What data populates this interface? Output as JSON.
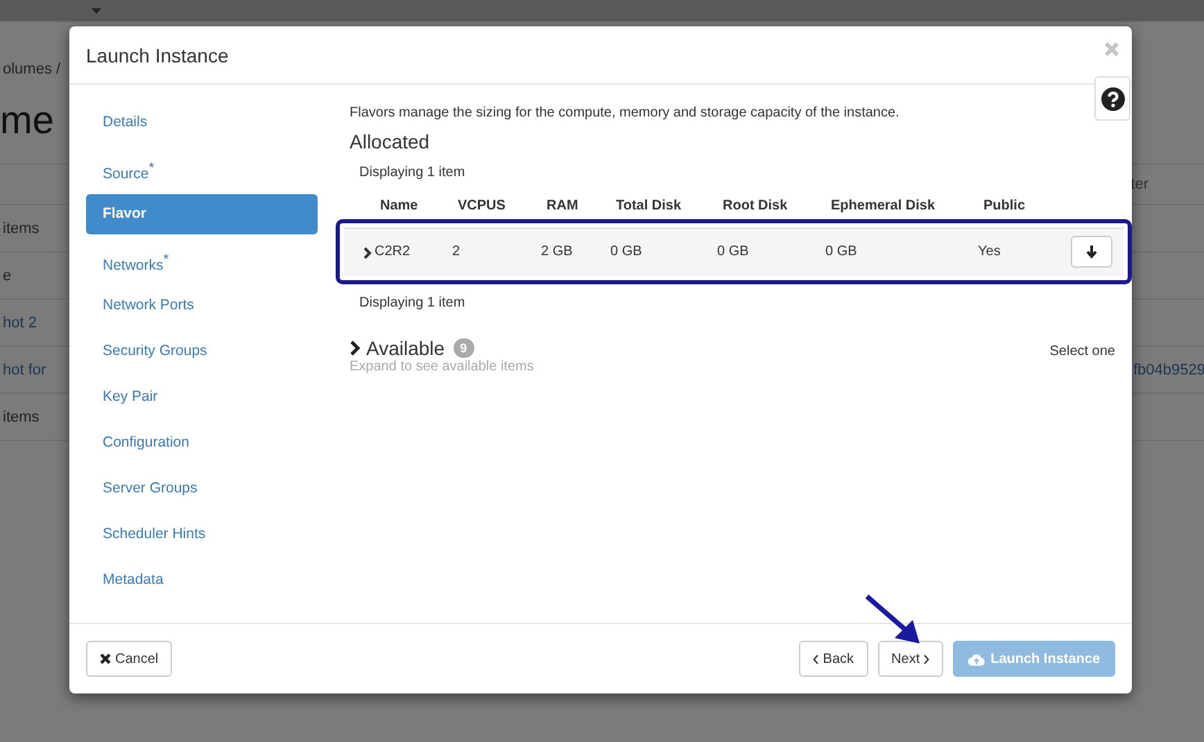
{
  "background_page": {
    "breadcrumb": "olumes /",
    "heading": "me",
    "filter_placeholder": "ter",
    "rows": [
      {
        "text": "items",
        "link": false
      },
      {
        "text": "e",
        "link": false
      },
      {
        "text": "hot 2",
        "link": true
      },
      {
        "text": "hot for",
        "link": true,
        "aside": "fb04b9529"
      },
      {
        "text": "items",
        "link": false
      }
    ]
  },
  "modal": {
    "title": "Launch Instance",
    "nav": [
      {
        "label": "Details",
        "selected": false
      },
      {
        "label": "Source",
        "selected": false,
        "required_mark": "*"
      },
      {
        "label": "Flavor",
        "selected": true
      },
      {
        "label": "Networks",
        "selected": false,
        "required_mark": "*"
      },
      {
        "label": "Network Ports",
        "selected": false
      },
      {
        "label": "Security Groups",
        "selected": false
      },
      {
        "label": "Key Pair",
        "selected": false
      },
      {
        "label": "Configuration",
        "selected": false
      },
      {
        "label": "Server Groups",
        "selected": false
      },
      {
        "label": "Scheduler Hints",
        "selected": false
      },
      {
        "label": "Metadata",
        "selected": false
      }
    ],
    "description": "Flavors manage the sizing for the compute, memory and storage capacity of the instance.",
    "allocated": {
      "title": "Allocated",
      "count_top": "Displaying 1 item",
      "count_bottom": "Displaying 1 item",
      "columns": [
        "Name",
        "VCPUS",
        "RAM",
        "Total Disk",
        "Root Disk",
        "Ephemeral Disk",
        "Public"
      ],
      "rows": [
        {
          "cells": [
            "C2R2",
            "2",
            "2 GB",
            "0 GB",
            "0 GB",
            "0 GB",
            "Yes"
          ],
          "highlighted": true
        }
      ]
    },
    "available": {
      "title": "Available",
      "badge": "9",
      "hint": "Expand to see available items",
      "expanded": false,
      "select_text": "Select one"
    },
    "footer": {
      "cancel": "Cancel",
      "back": "Back",
      "next": "Next",
      "launch": {
        "label": "Launch Instance",
        "disabled": true
      }
    }
  }
}
